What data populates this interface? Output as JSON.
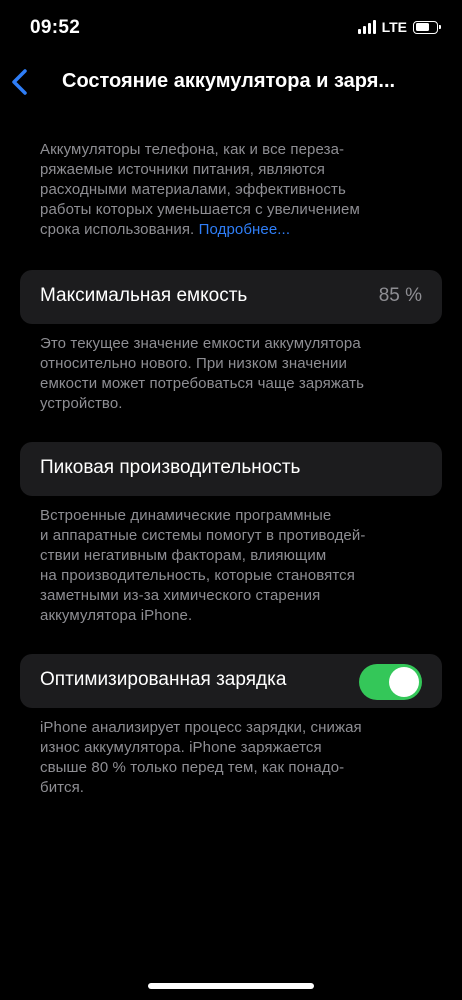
{
  "status_bar": {
    "time": "09:52",
    "network": "LTE"
  },
  "nav": {
    "title": "Состояние аккумулятора и заря..."
  },
  "intro": {
    "lines": [
      "Аккумуляторы телефона, как и все переза-",
      "ряжаемые источники питания, являются",
      "расходными материалами, эффективность",
      "работы которых уменьшается с увеличением"
    ],
    "last_line_text": "срока использования. ",
    "link": "Подробнее..."
  },
  "max_capacity": {
    "label": "Максимальная емкость",
    "value": "85 %",
    "description_lines": [
      "Это текущее значение емкости аккумулятора",
      "относительно нового. При низком значении",
      "емкости может потребоваться чаще заряжать",
      "устройство."
    ]
  },
  "peak_performance": {
    "label": "Пиковая производительность",
    "description_lines": [
      "Встроенные динамические программные",
      "и аппаратные системы помогут в противодей-",
      "ствии негативным факторам, влияющим",
      "на производительность, которые становятся",
      "заметными из-за химического старения",
      "аккумулятора iPhone."
    ]
  },
  "optimized_charging": {
    "label": "Оптимизированная зарядка",
    "enabled": true,
    "toggle_color": "#34c759",
    "description_lines": [
      "iPhone анализирует процесс зарядки, снижая",
      "износ аккумулятора. iPhone заряжается",
      "свыше 80 % только перед тем, как понадо-",
      "бится."
    ]
  }
}
